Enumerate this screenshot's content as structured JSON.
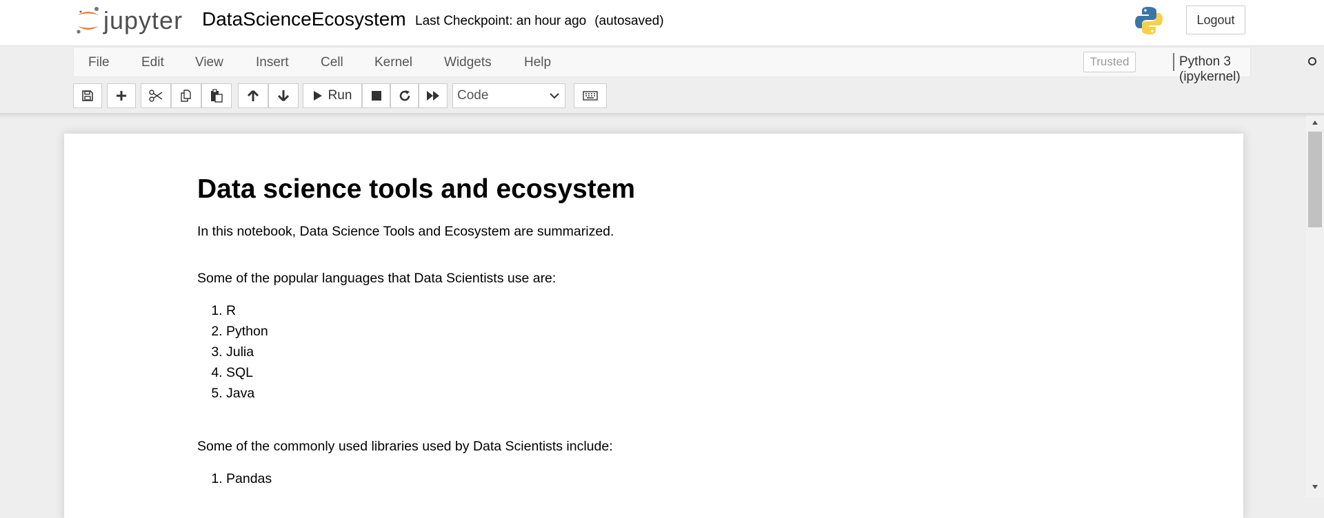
{
  "header": {
    "logo_text": "jupyter",
    "notebook_title": "DataScienceEcosystem",
    "checkpoint": "Last Checkpoint: an hour ago",
    "autosave_status": "(autosaved)",
    "logout_label": "Logout"
  },
  "menubar": {
    "items": [
      "File",
      "Edit",
      "View",
      "Insert",
      "Cell",
      "Kernel",
      "Widgets",
      "Help"
    ],
    "trusted_label": "Trusted",
    "kernel_name": "Python 3 (ipykernel)"
  },
  "toolbar": {
    "run_label": "Run",
    "cell_type": "Code",
    "icons": [
      "save-icon",
      "plus-icon",
      "cut-icon",
      "copy-icon",
      "paste-icon",
      "arrow-up-icon",
      "arrow-down-icon",
      "play-icon",
      "stop-icon",
      "restart-icon",
      "fast-forward-icon",
      "keyboard-icon"
    ]
  },
  "notebook": {
    "heading": "Data science tools and ecosystem",
    "intro": "In this notebook, Data Science Tools and Ecosystem are summarized.",
    "languages_intro": "Some of the popular languages that Data Scientists use are:",
    "languages": [
      "R",
      "Python",
      "Julia",
      "SQL",
      "Java"
    ],
    "libraries_intro": "Some of the commonly used libraries used by Data Scientists include:",
    "libraries": [
      "Pandas"
    ]
  },
  "colors": {
    "jupyter_orange": "#f37726",
    "page_background": "#eeeeee",
    "menubar_background": "#f8f8f8"
  }
}
